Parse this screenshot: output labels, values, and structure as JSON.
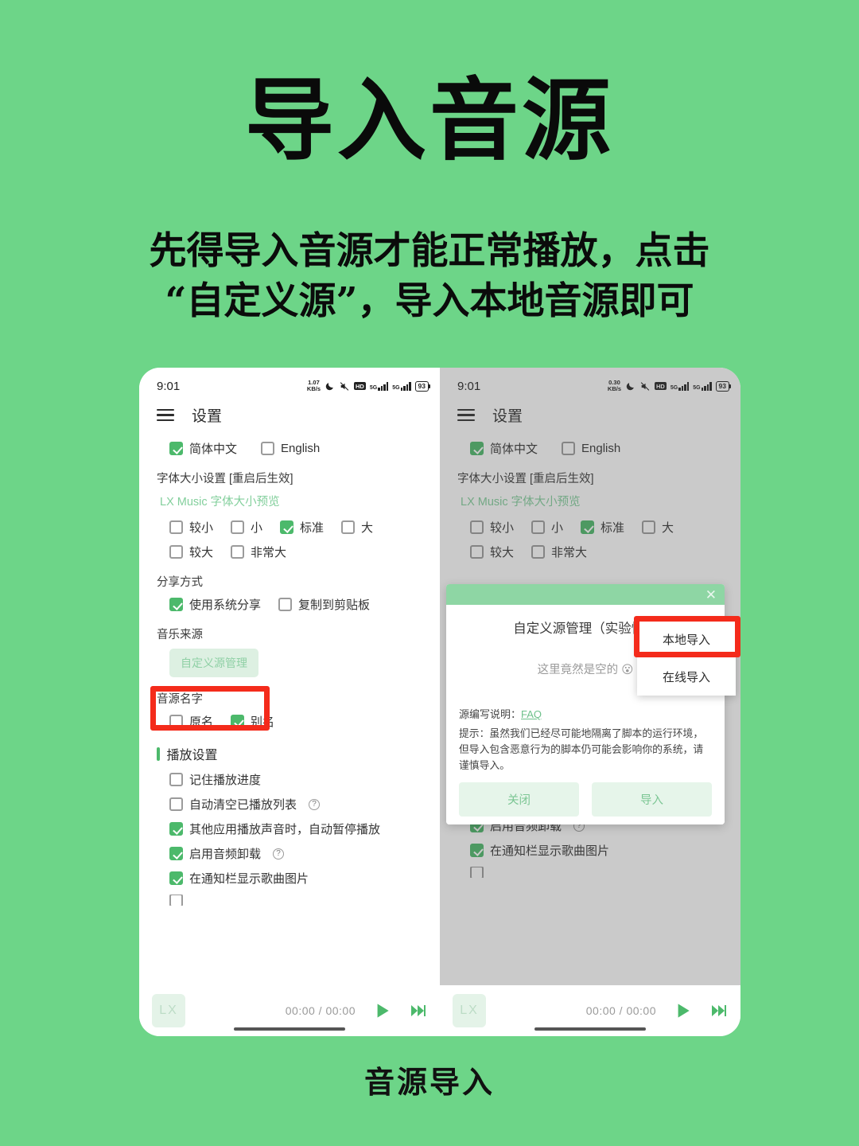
{
  "poster": {
    "title": "导入音源",
    "subtitle_line1": "先得导入音源才能正常播放，点击",
    "subtitle_line2": "“自定义源”，导入本地音源即可",
    "footer": "音源导入",
    "bg_color": "#6dd588",
    "accent_color": "#4cb96b",
    "highlight_color": "#f42b1b"
  },
  "phone_left": {
    "statusbar": {
      "clock": "9:01",
      "netspeed_value": "1.07",
      "netspeed_unit": "KB/s",
      "moon_icon": "moon-icon",
      "mute_icon": "mute-icon",
      "hd_badge": "HD",
      "sim1_net": "5G",
      "sim2_net": "5G",
      "battery": "93"
    },
    "appbar": {
      "menu_icon": "hamburger-icon",
      "title": "设置"
    },
    "language": {
      "options": [
        {
          "label": "简体中文",
          "checked": true
        },
        {
          "label": "English",
          "checked": false
        }
      ]
    },
    "font_size": {
      "section_label": "字体大小设置 [重启后生效]",
      "preview": "LX Music 字体大小预览",
      "options": [
        {
          "label": "较小",
          "checked": false
        },
        {
          "label": "小",
          "checked": false
        },
        {
          "label": "标准",
          "checked": true
        },
        {
          "label": "大",
          "checked": false
        },
        {
          "label": "较大",
          "checked": false
        },
        {
          "label": "非常大",
          "checked": false
        }
      ]
    },
    "share": {
      "section_label": "分享方式",
      "options": [
        {
          "label": "使用系统分享",
          "checked": true
        },
        {
          "label": "复制到剪贴板",
          "checked": false
        }
      ]
    },
    "music_source": {
      "section_label": "音乐来源",
      "button_label": "自定义源管理"
    },
    "source_name": {
      "section_label": "音源名字",
      "options": [
        {
          "label": "原名",
          "checked": false
        },
        {
          "label": "别名",
          "checked": true
        }
      ]
    },
    "playback": {
      "section_label": "播放设置",
      "options": [
        {
          "label": "记住播放进度",
          "checked": false,
          "help": false
        },
        {
          "label": "自动清空已播放列表",
          "checked": false,
          "help": true
        },
        {
          "label": "其他应用播放声音时，自动暂停播放",
          "checked": true,
          "help": false
        },
        {
          "label": "启用音频卸载",
          "checked": true,
          "help": true
        },
        {
          "label": "在通知栏显示歌曲图片",
          "checked": true,
          "help": false
        }
      ]
    },
    "player": {
      "cover_label": "LX",
      "time": "00:00 / 00:00",
      "play_icon": "play-icon",
      "next_icon": "next-track-icon"
    }
  },
  "phone_right": {
    "statusbar": {
      "clock": "9:01",
      "netspeed_value": "0.30",
      "netspeed_unit": "KB/s",
      "hd_badge": "HD",
      "sim1_net": "5G",
      "sim2_net": "5G",
      "battery": "93"
    },
    "appbar": {
      "title": "设置"
    },
    "dialog": {
      "close_icon": "close-icon",
      "title": "自定义源管理（实验性）",
      "empty_text": "这里竟然是空的 😮",
      "faq_label": "源编写说明：",
      "faq_link": "FAQ",
      "note": "提示：虽然我们已经尽可能地隔离了脚本的运行环境，但导入包含恶意行为的脚本仍可能会影响你的系统，请谨慎导入。",
      "close_button": "关闭",
      "import_button": "导入"
    },
    "import_menu": {
      "items": [
        {
          "label": "本地导入",
          "highlighted": true
        },
        {
          "label": "在线导入",
          "highlighted": false
        }
      ]
    },
    "player": {
      "cover_label": "LX",
      "time": "00:00 / 00:00",
      "play_icon": "play-icon",
      "next_icon": "next-track-icon"
    }
  }
}
